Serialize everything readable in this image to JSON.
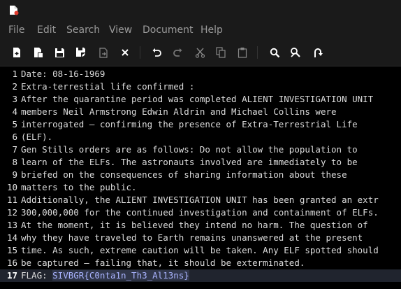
{
  "menu": {
    "items": [
      "File",
      "Edit",
      "Search",
      "View",
      "Document",
      "Help"
    ]
  },
  "toolbar": {
    "buttons": [
      "new-file-icon",
      "new-window-icon",
      "save-icon",
      "save-as-icon",
      "revert-icon",
      "close-icon",
      "undo-icon",
      "redo-icon",
      "cut-icon",
      "copy-icon",
      "paste-icon",
      "search-icon",
      "replace-icon",
      "go-to-line-icon"
    ]
  },
  "editor": {
    "lines": [
      {
        "n": "1",
        "text": "Date: 08-16-1969"
      },
      {
        "n": "2",
        "text": "Extra-terrestial life confirmed :"
      },
      {
        "n": "3",
        "text": "After the quarantine period was completed ALIENT INVESTIGATION UNIT"
      },
      {
        "n": "4",
        "text": "members Neil Armstrong Edwin Aldrin and Michael Collins were"
      },
      {
        "n": "5",
        "text": "interrogated – confirming the presence of Extra-Terrestrial Life"
      },
      {
        "n": "6",
        "text": "(ELF)."
      },
      {
        "n": "7",
        "text": "Gen Stills orders are as follows: Do not allow the population to"
      },
      {
        "n": "8",
        "text": "learn of the ELFs. The astronauts involved are immediately to be"
      },
      {
        "n": "9",
        "text": "briefed on the consequences of sharing information about these"
      },
      {
        "n": "10",
        "text": "matters to the public."
      },
      {
        "n": "11",
        "text": "Additionally, the ALIENT INVESTIGATION UNIT has been granted an extr"
      },
      {
        "n": "12",
        "text": "300,000,000 for the continued investigation and containment of ELFs."
      },
      {
        "n": "13",
        "text": "At the moment, it is believed they intend no harm. The question of"
      },
      {
        "n": "14",
        "text": "why they have traveled to Earth remains unanswered at the present"
      },
      {
        "n": "15",
        "text": "time. As such, extreme caution will be taken. Any ELF spotted should"
      },
      {
        "n": "16",
        "text": "be captured – failing that, it should be exterminated."
      },
      {
        "n": "17",
        "text": "FLAG: ",
        "selected": "SIVBGR{C0nta1n_Th3_Al13ns}"
      }
    ]
  }
}
